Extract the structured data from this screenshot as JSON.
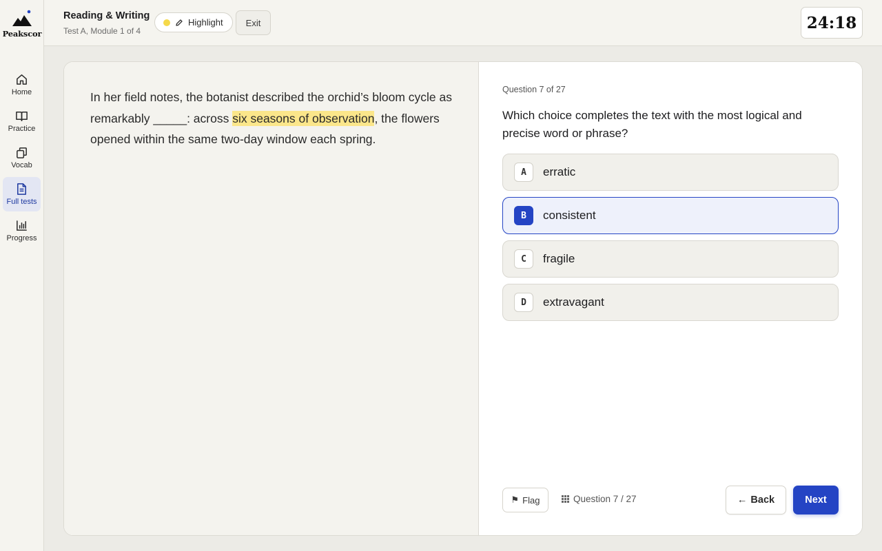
{
  "brand": {
    "name": "Peakscor"
  },
  "sidebar": {
    "items": [
      {
        "label": "Home",
        "icon": "home-icon"
      },
      {
        "label": "Practice",
        "icon": "book-icon"
      },
      {
        "label": "Vocab",
        "icon": "cards-icon"
      },
      {
        "label": "Full tests",
        "icon": "document-icon",
        "active": true
      },
      {
        "label": "Progress",
        "icon": "bar-chart-icon"
      }
    ]
  },
  "header": {
    "section_title": "Reading & Writing",
    "section_subtitle": "Test A, Module 1 of 4",
    "highlight_label": "Highlight",
    "exit_label": "Exit",
    "timer": "24:18"
  },
  "passage": {
    "before_highlight": "In her field notes, the botanist described the orchid’s bloom cycle as remarkably _____: across ",
    "highlighted": "six seasons of observation",
    "after_highlight": ", the flowers opened within the same two-day window each spring."
  },
  "question": {
    "number_label": "Question 7 of 27",
    "stem": "Which choice completes the text with the most logical and precise word or phrase?",
    "choices": [
      {
        "letter": "A",
        "text": "erratic"
      },
      {
        "letter": "B",
        "text": "consistent"
      },
      {
        "letter": "C",
        "text": "fragile"
      },
      {
        "letter": "D",
        "text": "extravagant"
      }
    ],
    "selected": "B"
  },
  "footer": {
    "flag_icon": "⚑",
    "flag_label": "Flag",
    "nav_label": "Question 7 / 27",
    "back_arrow": "←",
    "back_label": "Back",
    "next_label": "Next"
  },
  "colors": {
    "accent": "#2444c4",
    "highlight": "#fbe68a",
    "background": "#ecebe6",
    "panel": "#f4f3ee"
  }
}
